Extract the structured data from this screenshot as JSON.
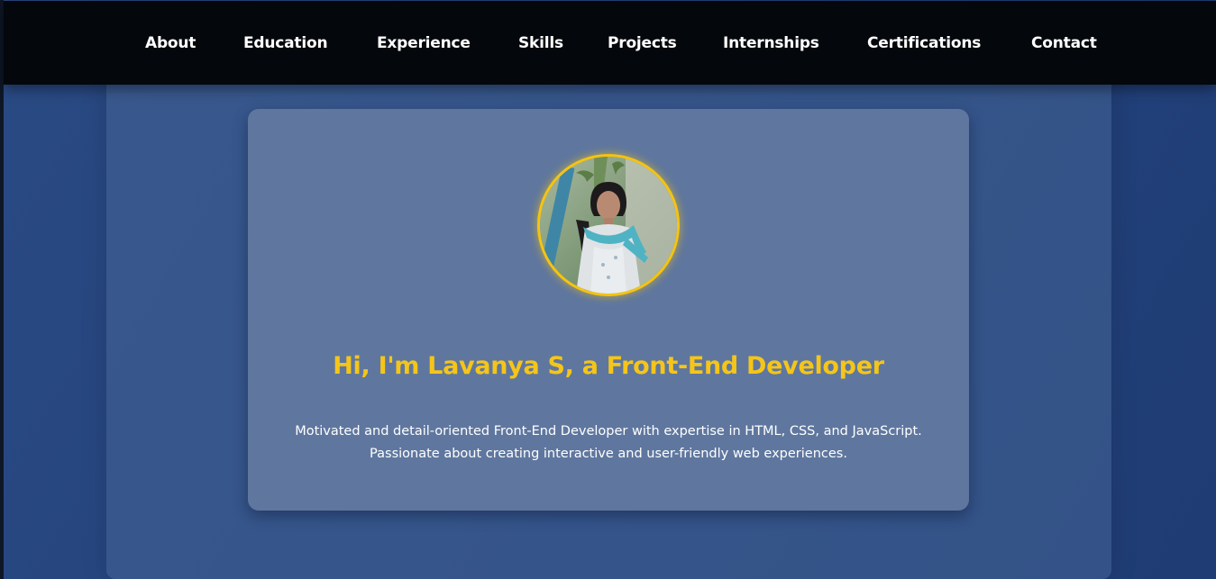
{
  "nav": {
    "items": [
      {
        "label": "About"
      },
      {
        "label": "Education"
      },
      {
        "label": "Experience"
      },
      {
        "label": "Skills"
      },
      {
        "label": "Projects"
      },
      {
        "label": "Internships"
      },
      {
        "label": "Certifications"
      },
      {
        "label": "Contact"
      }
    ]
  },
  "hero": {
    "title": "Hi, I'm Lavanya S, a Front-End Developer",
    "description": "Motivated and detail-oriented Front-End Developer with expertise in HTML, CSS, and JavaScript. Passionate about creating interactive and user-friendly web experiences."
  },
  "colors": {
    "accent": "#f5c518",
    "navbar": "#04070c",
    "card": "#5f779f",
    "background": "#23427c"
  }
}
